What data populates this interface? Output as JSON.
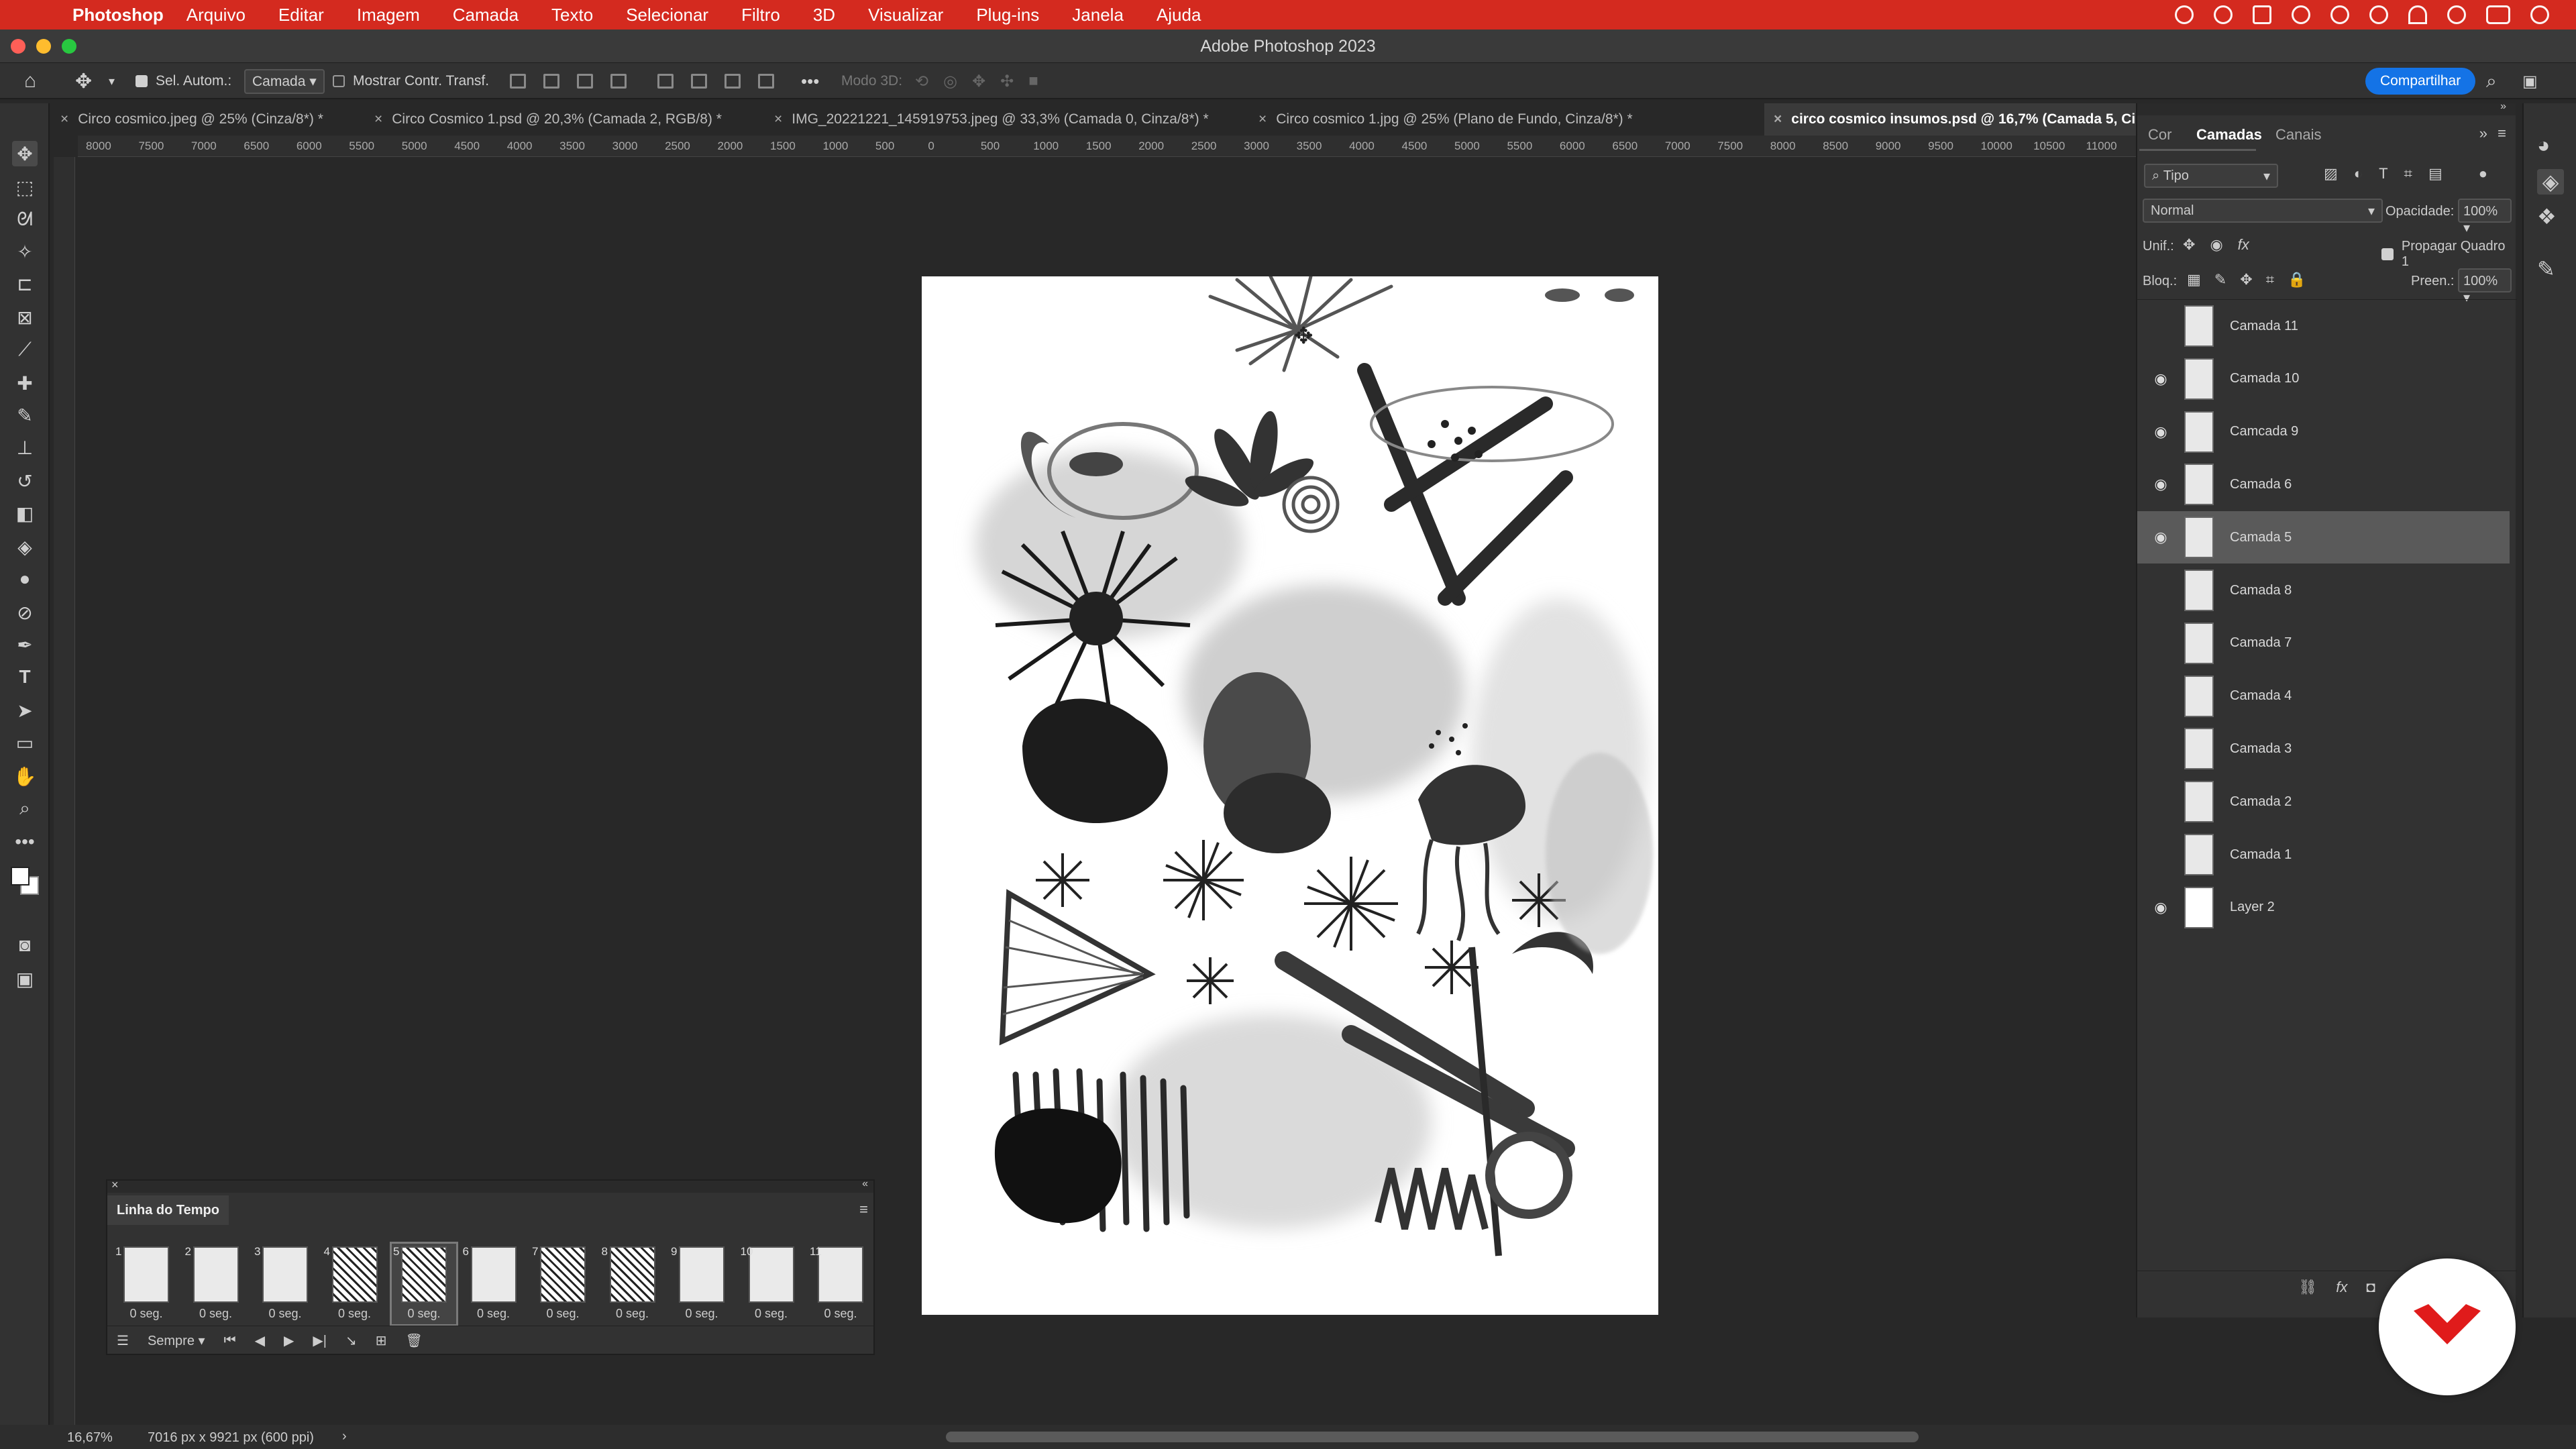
{
  "menu": {
    "app": "Photoshop",
    "items": [
      "Arquivo",
      "Editar",
      "Imagem",
      "Camada",
      "Texto",
      "Selecionar",
      "Filtro",
      "3D",
      "Visualizar",
      "Plug-ins",
      "Janela",
      "Ajuda"
    ]
  },
  "window": {
    "title": "Adobe Photoshop 2023"
  },
  "options": {
    "auto_select_label": "Sel. Autom.:",
    "auto_select_value": "Camada",
    "show_transform_label": "Mostrar Contr. Transf.",
    "mode3d_label": "Modo 3D:",
    "share_label": "Compartilhar"
  },
  "tabs": [
    {
      "label": "Circo cosmico.jpeg @ 25% (Cinza/8*) *"
    },
    {
      "label": "Circo Cosmico 1.psd @ 20,3% (Camada 2, RGB/8) *"
    },
    {
      "label": "IMG_20221221_145919753.jpeg @ 33,3% (Camada 0, Cinza/8*) *"
    },
    {
      "label": "Circo cosmico 1.jpg @ 25% (Plano de Fundo, Cinza/8*) *"
    },
    {
      "label": "circo cosmico insumos.psd @ 16,7% (Camada 5, Cinza/8)"
    }
  ],
  "ruler": {
    "top_ticks": [
      "8000",
      "7500",
      "7000",
      "6500",
      "6000",
      "5500",
      "5000",
      "4500",
      "4000",
      "3500",
      "3000",
      "2500",
      "2000",
      "1500",
      "1000",
      "500",
      "0",
      "500",
      "1000",
      "1500",
      "2000",
      "2500",
      "3000",
      "3500",
      "4000",
      "4500",
      "5000",
      "5500",
      "6000",
      "6500",
      "7000",
      "7500",
      "8000",
      "8500",
      "9000",
      "9500",
      "10000",
      "10500",
      "11000"
    ]
  },
  "timeline": {
    "title": "Linha do Tempo",
    "frames": [
      {
        "num": "1",
        "dur": "0 seg."
      },
      {
        "num": "2",
        "dur": "0 seg."
      },
      {
        "num": "3",
        "dur": "0 seg."
      },
      {
        "num": "4",
        "dur": "0 seg."
      },
      {
        "num": "5",
        "dur": "0 seg."
      },
      {
        "num": "6",
        "dur": "0 seg."
      },
      {
        "num": "7",
        "dur": "0 seg."
      },
      {
        "num": "8",
        "dur": "0 seg."
      },
      {
        "num": "9",
        "dur": "0 seg."
      },
      {
        "num": "10",
        "dur": "0 seg."
      },
      {
        "num": "11",
        "dur": "0 seg."
      }
    ],
    "selected_frame": 5,
    "loop_value": "Sempre"
  },
  "layers_panel": {
    "tabs": [
      "Cor",
      "Camadas",
      "Canais"
    ],
    "active_tab": "Camadas",
    "filter_label": "Tipo",
    "blend_mode": "Normal",
    "opacity_label": "Opacidade:",
    "opacity_value": "100%",
    "unify_label": "Unif.:",
    "propagate_label": "Propagar Quadro 1",
    "lock_label": "Bloq.:",
    "fill_label": "Preen.:",
    "fill_value": "100%",
    "layers": [
      {
        "name": "Camada 11",
        "visible": false
      },
      {
        "name": "Camada 10",
        "visible": true
      },
      {
        "name": "Camcada 9",
        "visible": true
      },
      {
        "name": "Camada 6",
        "visible": true
      },
      {
        "name": "Camada 5",
        "visible": true,
        "selected": true
      },
      {
        "name": "Camada 8",
        "visible": false
      },
      {
        "name": "Camada 7",
        "visible": false
      },
      {
        "name": "Camada 4",
        "visible": false
      },
      {
        "name": "Camada 3",
        "visible": false
      },
      {
        "name": "Camada 2",
        "visible": false
      },
      {
        "name": "Camada 1",
        "visible": false
      },
      {
        "name": "Layer 2",
        "visible": true
      }
    ]
  },
  "status": {
    "zoom": "16,67%",
    "doc_info": "7016 px x 9921 px (600 ppi)"
  },
  "colors": {
    "menubar": "#d42a1f",
    "accent": "#1473e6",
    "panel": "#323232",
    "canvas_bg": "#282828"
  }
}
